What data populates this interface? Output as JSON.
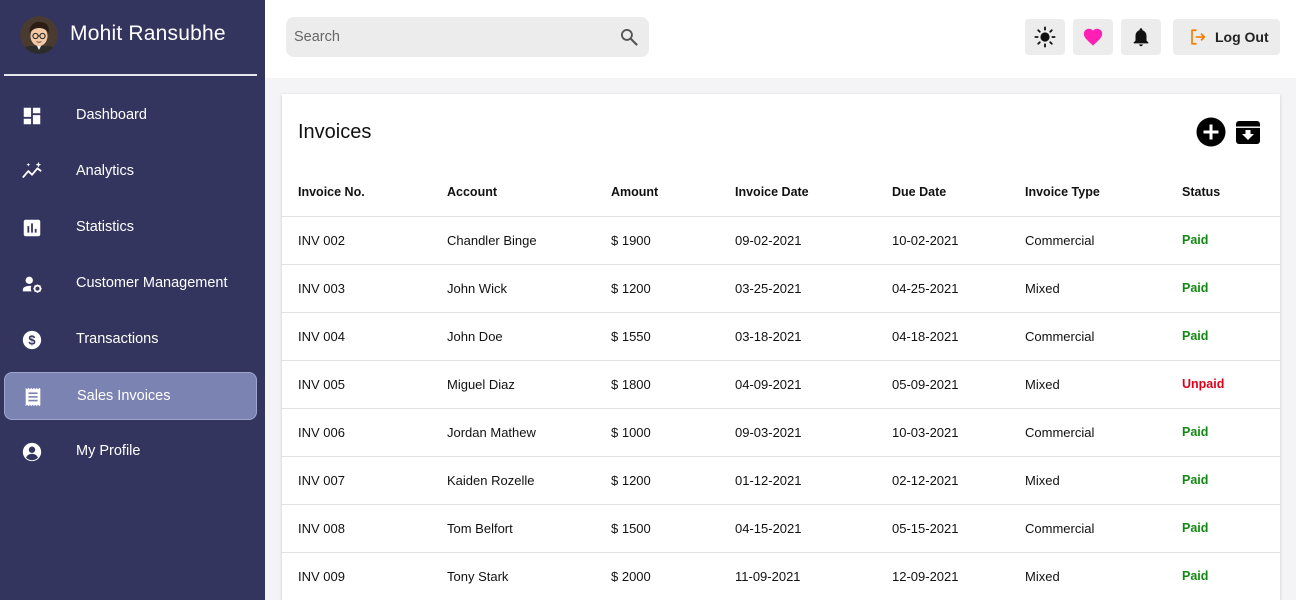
{
  "user": {
    "name": "Mohit Ransubhe"
  },
  "sidebar": {
    "items": [
      {
        "label": "Dashboard",
        "icon": "dashboard-icon"
      },
      {
        "label": "Analytics",
        "icon": "analytics-icon"
      },
      {
        "label": "Statistics",
        "icon": "statistics-icon"
      },
      {
        "label": "Customer Management",
        "icon": "customer-management-icon"
      },
      {
        "label": "Transactions",
        "icon": "dollar-icon"
      },
      {
        "label": "Sales Invoices",
        "icon": "receipt-icon",
        "active": true
      },
      {
        "label": "My Profile",
        "icon": "account-circle-icon"
      }
    ]
  },
  "topbar": {
    "search_placeholder": "Search",
    "logout_label": "Log Out"
  },
  "colors": {
    "sidebar_bg": "#33355e",
    "active_item": "#7b83b2",
    "heart": "#ff1fb4",
    "logout_icon": "#f57c00",
    "paid": "#118a11",
    "unpaid": "#e0001a"
  },
  "invoices": {
    "title": "Invoices",
    "columns": [
      "Invoice No.",
      "Account",
      "Amount",
      "Invoice Date",
      "Due Date",
      "Invoice Type",
      "Status"
    ],
    "rows": [
      {
        "no": "INV 002",
        "account": "Chandler Binge",
        "amount": "$ 1900",
        "invoice_date": "09-02-2021",
        "due_date": "10-02-2021",
        "type": "Commercial",
        "status": "Paid"
      },
      {
        "no": "INV 003",
        "account": "John Wick",
        "amount": "$ 1200",
        "invoice_date": "03-25-2021",
        "due_date": "04-25-2021",
        "type": "Mixed",
        "status": "Paid"
      },
      {
        "no": "INV 004",
        "account": "John Doe",
        "amount": "$ 1550",
        "invoice_date": "03-18-2021",
        "due_date": "04-18-2021",
        "type": "Commercial",
        "status": "Paid"
      },
      {
        "no": "INV 005",
        "account": "Miguel Diaz",
        "amount": "$ 1800",
        "invoice_date": "04-09-2021",
        "due_date": "05-09-2021",
        "type": "Mixed",
        "status": "Unpaid"
      },
      {
        "no": "INV 006",
        "account": "Jordan Mathew",
        "amount": "$ 1000",
        "invoice_date": "09-03-2021",
        "due_date": "10-03-2021",
        "type": "Commercial",
        "status": "Paid"
      },
      {
        "no": "INV 007",
        "account": "Kaiden Rozelle",
        "amount": "$ 1200",
        "invoice_date": "01-12-2021",
        "due_date": "02-12-2021",
        "type": "Mixed",
        "status": "Paid"
      },
      {
        "no": "INV 008",
        "account": "Tom Belfort",
        "amount": "$ 1500",
        "invoice_date": "04-15-2021",
        "due_date": "05-15-2021",
        "type": "Commercial",
        "status": "Paid"
      },
      {
        "no": "INV 009",
        "account": "Tony Stark",
        "amount": "$ 2000",
        "invoice_date": "11-09-2021",
        "due_date": "12-09-2021",
        "type": "Mixed",
        "status": "Paid"
      }
    ]
  }
}
